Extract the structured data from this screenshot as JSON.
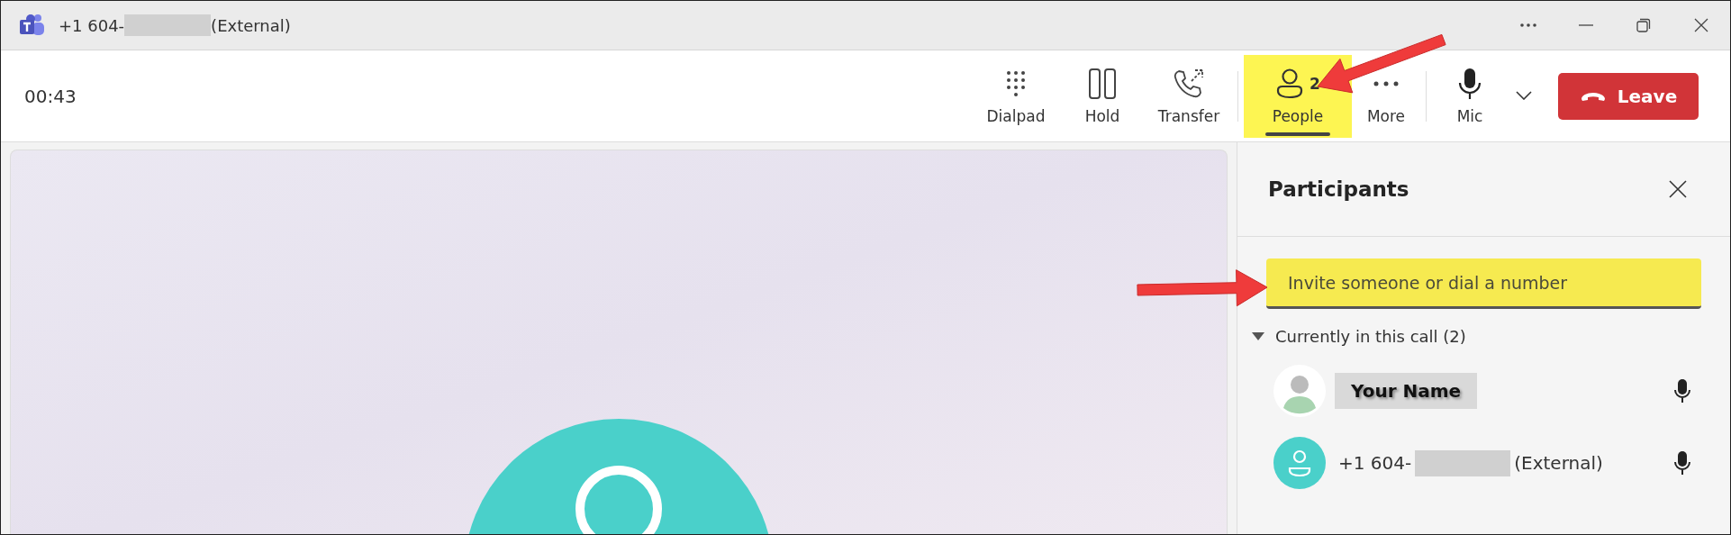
{
  "title_bar": {
    "caller_prefix": "+1 604-",
    "caller_redacted": true,
    "caller_suffix": "(External)"
  },
  "toolbar": {
    "timer": "00:43",
    "buttons": [
      {
        "kind": "dialpad",
        "label": "Dialpad",
        "selected": false,
        "highlighted": false
      },
      {
        "kind": "hold",
        "label": "Hold",
        "selected": false,
        "highlighted": false
      },
      {
        "kind": "transfer",
        "label": "Transfer",
        "selected": false,
        "highlighted": false
      },
      {
        "kind": "people",
        "label": "People",
        "badge": "2",
        "selected": true,
        "highlighted": true,
        "annotated": true
      },
      {
        "kind": "more",
        "label": "More",
        "selected": false,
        "highlighted": false
      },
      {
        "kind": "mic",
        "label": "Mic",
        "selected": false,
        "highlighted": false
      }
    ],
    "leave": {
      "label": "Leave"
    }
  },
  "participants_panel": {
    "title": "Participants",
    "invite": {
      "placeholder": "Invite someone or dial a number",
      "highlighted": true,
      "annotated": true
    },
    "section": {
      "label": "Currently in this call (2)",
      "expanded": true
    },
    "people": [
      {
        "kind": "self",
        "name": "Your Name"
      },
      {
        "kind": "external",
        "name_prefix": "+1 604-",
        "redacted": true,
        "name_suffix": "(External)"
      }
    ]
  }
}
